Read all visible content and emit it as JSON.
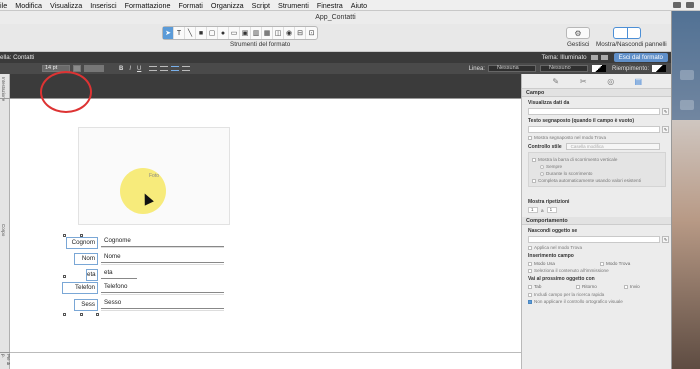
{
  "menubar": {
    "items": [
      "ile",
      "Modifica",
      "Visualizza",
      "Inserisci",
      "Formattazione",
      "Formati",
      "Organizza",
      "Script",
      "Strumenti",
      "Finestra",
      "Aiuto"
    ]
  },
  "window": {
    "title": "App_Contatti"
  },
  "toolbar": {
    "tools": [
      "pointer",
      "text",
      "line",
      "rectangle",
      "rounded-rectangle",
      "oval",
      "field",
      "button",
      "chart",
      "portal",
      "popover",
      "web-viewer",
      "tab-control",
      "slide-control"
    ],
    "tools_label": "Strumenti del formato",
    "manage_label": "Gestisci",
    "panels_label": "Mostra/Nascondi pannelli"
  },
  "layoutbar": {
    "layout_name": "ella: Contatti",
    "theme_label": "Tema: Illuminato",
    "exit_label": "Esci dal formato"
  },
  "formatbar": {
    "font_size": "14 pt",
    "bold": "B",
    "italic": "I",
    "underline": "U",
    "line_label": "Linea:",
    "line_value": "Nessuna",
    "line_pattern": "Nessuno",
    "fill_label": "Riempimento:"
  },
  "canvas": {
    "part_header": "Intestazione",
    "part_body": "Corpo",
    "part_footer": "Pié di p.",
    "photo_label": "Foto",
    "labels": [
      "Cognom",
      "Nom",
      "eta",
      "Telefon",
      "Sess"
    ],
    "fields": [
      "Cognome",
      "Nome",
      "eta",
      "Telefono",
      "Sesso"
    ]
  },
  "inspector": {
    "tabs": [
      "position-tab",
      "appearance-tab",
      "data-tab",
      "settings-tab"
    ],
    "section_field": "Campo",
    "show_data_from": "Visualizza dati da",
    "placeholder_text": "Testo segnaposto (quando il campo è vuoto)",
    "show_placeholder_find": "Mostra segnaposto nel modo Trova",
    "control_style_label": "Controllo stile",
    "control_style_value": "Casella modifica",
    "scrollbar_label": "Mostra la barra di scorrimento verticale",
    "always": "Sempre",
    "while_scrolling": "Durante lo scorrimento",
    "autocomplete": "Completa automaticamente usando valori esistenti",
    "repetitions_label": "Mostra ripetizioni",
    "rep_from": "1",
    "rep_to_label": "a",
    "rep_to": "1",
    "section_behavior": "Comportamento",
    "hide_object_label": "Nascondi oggetto se",
    "apply_find": "Applica nel modo Trova",
    "field_entry_label": "Inserimento campo",
    "browse_mode": "Modo Usa",
    "find_mode": "Modo Trova",
    "select_content": "Seleziona il contenuto all'immissione",
    "next_object_label": "Vai al prossimo oggetto con",
    "key_tab": "Tab",
    "key_return": "Ritorno",
    "key_enter": "Invio",
    "quick_find": "Includi campo per la ricerca rapida",
    "spellcheck": "Non applicare il controllo ortografico visuale"
  }
}
